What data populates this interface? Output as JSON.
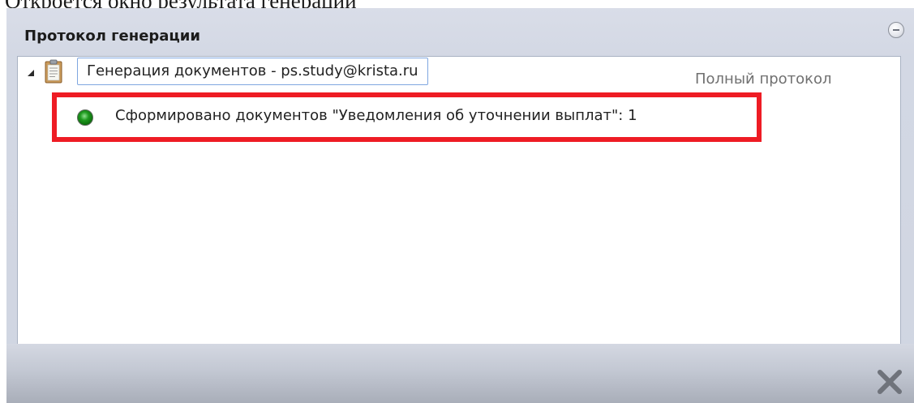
{
  "page_caption": "Откроется окно результата генерации",
  "dialog": {
    "title": "Протокол генерации",
    "collapse_icon": "collapse-circle-icon",
    "close_icon": "close-x-icon"
  },
  "tree": {
    "root": {
      "icon": "clipboard-icon",
      "label": "Генерация документов - ps.study@krista.ru",
      "expanded": true
    },
    "full_log_link": "Полный протокол",
    "children": [
      {
        "icon": "green-status-icon",
        "label": "Сформировано документов \"Уведомления об уточнении выплат\": 1"
      }
    ]
  },
  "colors": {
    "highlight_border": "#ee1c24",
    "status_green": "#1f9a1f",
    "dialog_background": "#d3d8e4"
  }
}
